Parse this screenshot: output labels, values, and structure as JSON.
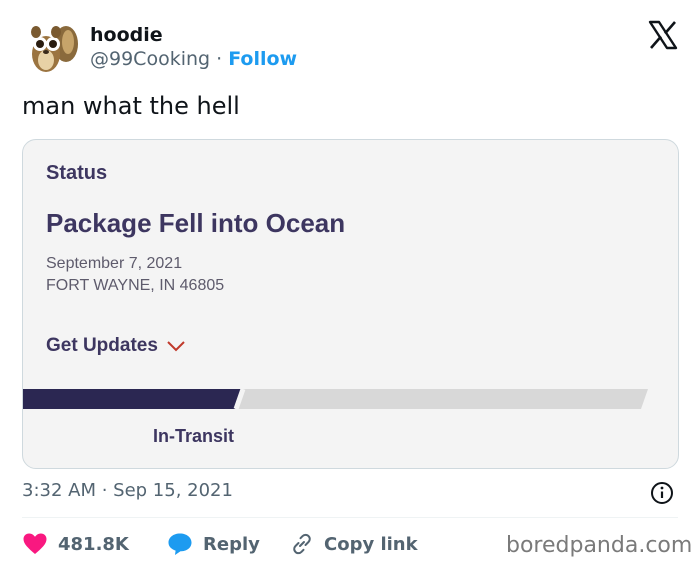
{
  "author": {
    "name": "hoodie",
    "handle": "@99Cooking",
    "separator": "·",
    "follow_label": "Follow"
  },
  "tweet": {
    "text": "man what the hell",
    "time": "3:32 AM · Sep 15, 2021"
  },
  "card": {
    "status_label": "Status",
    "headline": "Package Fell into Ocean",
    "date": "September 7, 2021",
    "location": "FORT WAYNE, IN 46805",
    "updates_label": "Get Updates",
    "progress_fraction": 0.35,
    "progress_stage": "In-Transit",
    "colors": {
      "progress_fill": "#2b2752",
      "progress_track": "#d8d8d8",
      "chevron": "#c0392b"
    }
  },
  "actions": {
    "likes": "481.8K",
    "reply_label": "Reply",
    "copy_label": "Copy link"
  },
  "watermark": "boredpanda.com",
  "colors": {
    "like": "#f91880",
    "reply": "#1d9bf0",
    "link": "#1d9bf0"
  },
  "icons": [
    "avatar",
    "x-logo-icon",
    "chevron-down-icon",
    "info-icon",
    "heart-icon",
    "reply-bubble-icon",
    "link-icon"
  ]
}
